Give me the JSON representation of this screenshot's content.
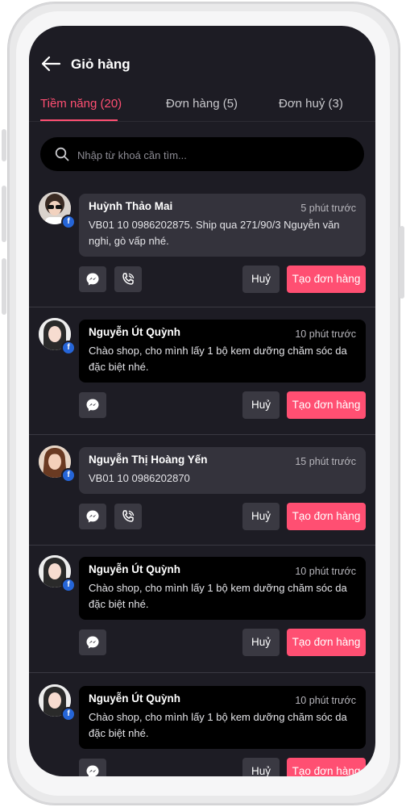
{
  "header": {
    "title": "Giỏ hàng"
  },
  "tabs": [
    {
      "label": "Tiềm năng (20)"
    },
    {
      "label": "Đơn hàng (5)"
    },
    {
      "label": "Đơn huỷ (3)"
    }
  ],
  "search": {
    "placeholder": "Nhập từ khoá cần tìm..."
  },
  "items": [
    {
      "name": "Huỳnh Thảo Mai",
      "time": "5 phút trước",
      "message_line1": "VB01 10 0986202875. Ship qua 271/90/3 Nguyễn văn",
      "message_line2": "nghi, gò vấp nhé.",
      "cancel": "Huỷ",
      "create": "Tạo đơn hàng"
    },
    {
      "name": "Nguyễn Út Quỳnh",
      "time": "10 phút trước",
      "message_line1": "Chào shop, cho mình lấy 1 bộ kem dưỡng chăm sóc da",
      "message_line2": "đặc biệt nhé.",
      "cancel": "Huỷ",
      "create": "Tạo đơn hàng"
    },
    {
      "name": "Nguyễn Thị Hoàng Yến",
      "time": "15 phút trước",
      "message_line1": "VB01 10 0986202870",
      "message_line2": "",
      "cancel": "Huỷ",
      "create": "Tạo đơn hàng"
    },
    {
      "name": "Nguyễn Út Quỳnh",
      "time": "10 phút trước",
      "message_line1": "Chào shop, cho mình lấy 1 bộ kem dưỡng chăm sóc da",
      "message_line2": "đặc biệt nhé.",
      "cancel": "Huỷ",
      "create": "Tạo đơn hàng"
    },
    {
      "name": "Nguyễn Út Quỳnh",
      "time": "10 phút trước",
      "message_line1": "Chào shop, cho mình lấy 1 bộ kem dưỡng chăm sóc da",
      "message_line2": "đặc biệt nhé.",
      "cancel": "Huỷ",
      "create": "Tạo đơn hàng"
    }
  ],
  "colors": {
    "accent": "#ff4f72",
    "background": "#1d1c24",
    "facebook": "#2565d8"
  },
  "icons": [
    "back-arrow-icon",
    "search-icon",
    "facebook-icon",
    "messenger-icon",
    "phone-call-icon"
  ]
}
